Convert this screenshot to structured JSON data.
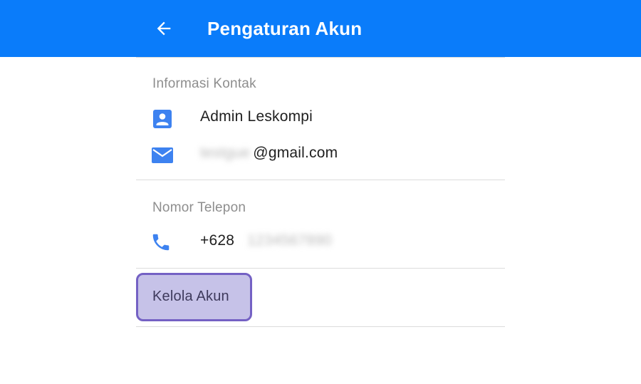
{
  "header": {
    "title": "Pengaturan Akun",
    "background_color": "#0a7cfa",
    "back_icon": "arrow-left-icon"
  },
  "contact_section": {
    "label": "Informasi Kontak",
    "name": "Admin Leskompi",
    "email_hidden_part": "testgue",
    "email_domain": "@gmail.com",
    "name_icon": "account-box-icon",
    "email_icon": "mail-icon"
  },
  "phone_section": {
    "label": "Nomor Telepon",
    "prefix": "+628",
    "hidden_number": "1234567890",
    "phone_icon": "phone-icon"
  },
  "manage_account": {
    "label": "Kelola Akun",
    "highlight_color": "#c6c2e8",
    "border_color": "#7461c4"
  },
  "accent_color": "#3d82f0"
}
